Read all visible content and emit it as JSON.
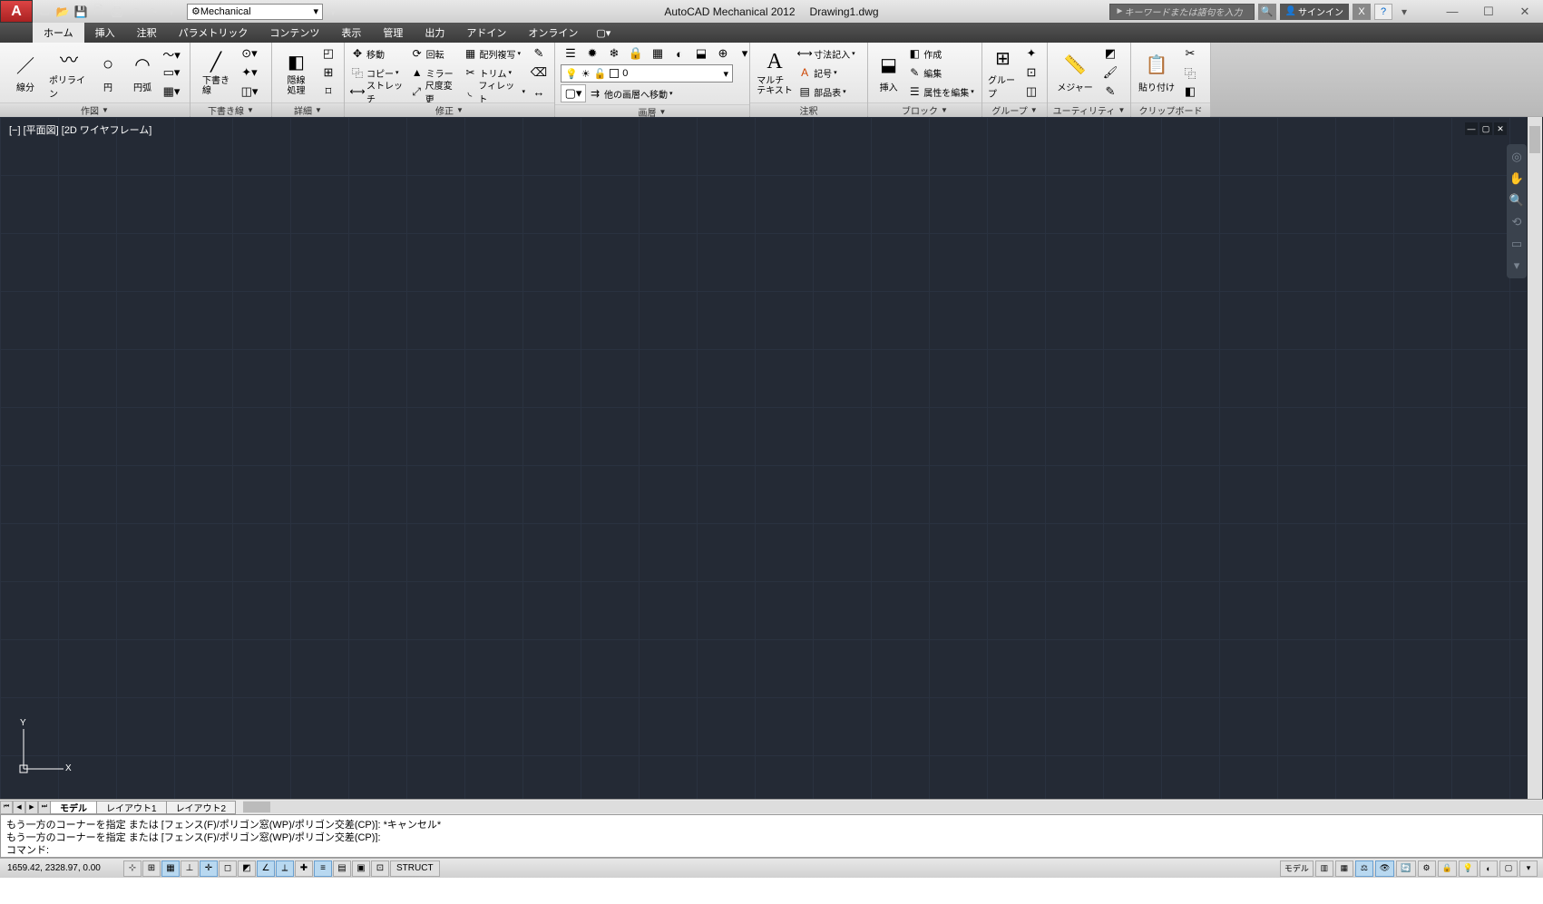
{
  "title": {
    "app": "AutoCAD Mechanical 2012",
    "file": "Drawing1.dwg"
  },
  "qat_workspace": "Mechanical",
  "search_placeholder": "キーワードまたは語句を入力",
  "signin": "サインイン",
  "tabs": [
    "ホーム",
    "挿入",
    "注釈",
    "パラメトリック",
    "コンテンツ",
    "表示",
    "管理",
    "出力",
    "アドイン",
    "オンライン"
  ],
  "ribbon": {
    "sakuzu": {
      "title": "作図",
      "line": "線分",
      "polyline": "ポリライン",
      "circle": "円",
      "arc": "円弧"
    },
    "shitagaki": {
      "title": "下書き線",
      "btn": "下書き\n線"
    },
    "shousai": {
      "title": "詳細",
      "btn": "隠線\n処理"
    },
    "shusei": {
      "title": "修正",
      "move": "移動",
      "copy": "コピー",
      "stretch": "ストレッチ",
      "rotate": "回転",
      "mirror": "ミラー",
      "scale": "尺度変更",
      "array": "配列複写",
      "trim": "トリム",
      "fillet": "フィレット"
    },
    "gasou": {
      "title": "画層",
      "layer_value": "0",
      "other": "他の画層へ移動"
    },
    "chushaku": {
      "title": "注釈",
      "mtext": "マルチ\nテキスト",
      "dim": "寸法記入",
      "sym": "記号",
      "bom": "部品表"
    },
    "block": {
      "title": "ブロック",
      "insert": "挿入",
      "create": "作成",
      "edit": "編集",
      "battr": "属性を編集"
    },
    "group": {
      "title": "グループ",
      "btn": "グループ"
    },
    "utility": {
      "title": "ユーティリティ",
      "measure": "メジャー"
    },
    "clipboard": {
      "title": "クリップボード",
      "paste": "貼り付け"
    }
  },
  "viewport_label": "[−] [平面図] [2D ワイヤフレーム]",
  "model_tabs": [
    "モデル",
    "レイアウト1",
    "レイアウト2"
  ],
  "cmd": {
    "l1": "もう一方のコーナーを指定 または [フェンス(F)/ポリゴン窓(WP)/ポリゴン交差(CP)]: *キャンセル*",
    "l2": "もう一方のコーナーを指定 または [フェンス(F)/ポリゴン窓(WP)/ポリゴン交差(CP)]:",
    "prompt": "コマンド:"
  },
  "status": {
    "coords": "1659.42, 2328.97, 0.00",
    "struct": "STRUCT",
    "model_btn": "モデル"
  }
}
